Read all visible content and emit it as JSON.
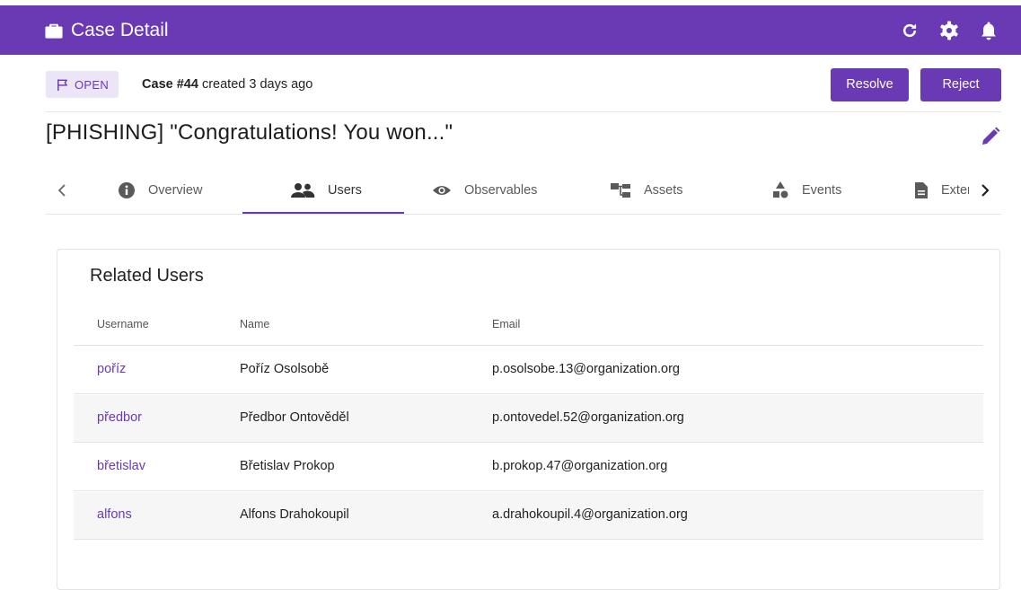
{
  "header": {
    "title": "Case Detail",
    "icons": [
      "briefcase-icon",
      "refresh-icon",
      "settings-icon",
      "notifications-icon"
    ],
    "accent_color": "#6a3ab5"
  },
  "status": {
    "badge": "OPEN",
    "case_number": "Case #44",
    "created_text": " created 3 days ago",
    "resolve_label": "Resolve",
    "reject_label": "Reject"
  },
  "case": {
    "title": "[PHISHING] \"Congratulations! You won...\""
  },
  "tabs": [
    {
      "label": "Overview",
      "icon": "info-icon"
    },
    {
      "label": "Users",
      "icon": "users-icon"
    },
    {
      "label": "Observables",
      "icon": "eye-icon"
    },
    {
      "label": "Assets",
      "icon": "assets-icon"
    },
    {
      "label": "Events",
      "icon": "shapes-icon"
    },
    {
      "label": "Exter",
      "icon": "document-icon"
    }
  ],
  "active_tab": "Users",
  "users_panel": {
    "title": "Related Users",
    "columns": [
      "Username",
      "Name",
      "Email"
    ],
    "rows": [
      {
        "username": "poříz",
        "name": "Poříz Osolsobě",
        "email": "p.osolsobe.13@organization.org"
      },
      {
        "username": "předbor",
        "name": "Předbor Ontověděl",
        "email": "p.ontovedel.52@organization.org"
      },
      {
        "username": "břetislav",
        "name": "Břetislav Prokop",
        "email": "b.prokop.47@organization.org"
      },
      {
        "username": "alfons",
        "name": "Alfons Drahokoupil",
        "email": "a.drahokoupil.4@organization.org"
      }
    ]
  }
}
